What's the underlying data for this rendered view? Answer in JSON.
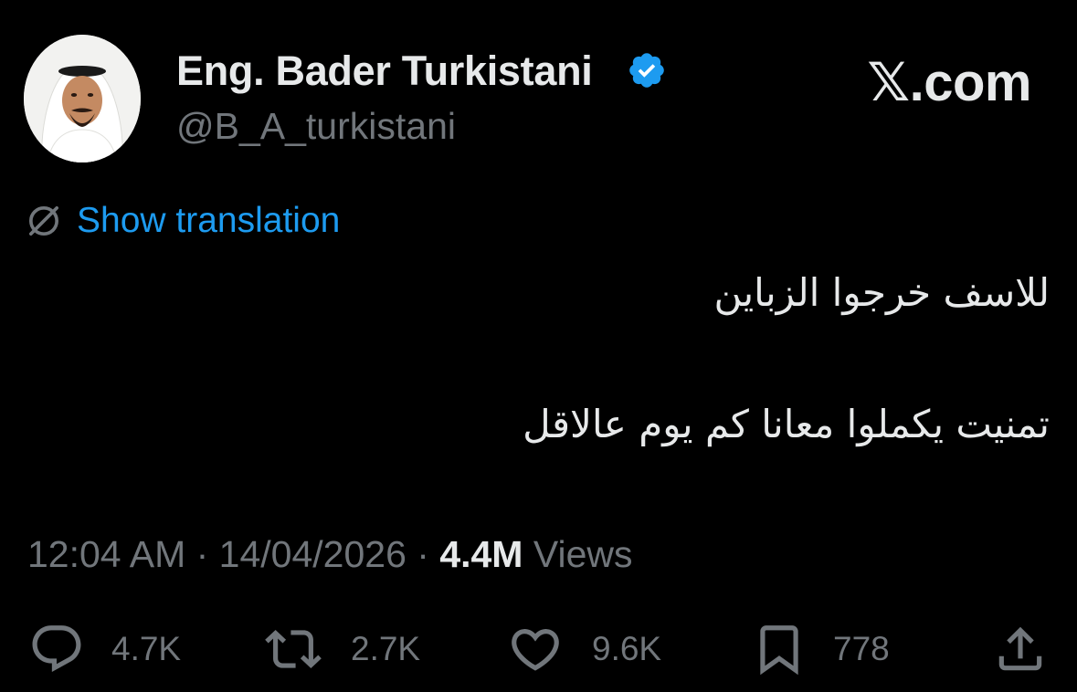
{
  "author": {
    "display_name": "Eng. Bader Turkistani",
    "handle": "@B_A_turkistani"
  },
  "brand": "𝕏.com",
  "translate": {
    "label": "Show translation",
    "icon": "globe-icon"
  },
  "tweet": {
    "lines": [
      "للاسف خرجوا الزباين",
      "تمنيت يكملوا معانا كم يوم عالاقل"
    ]
  },
  "meta": {
    "time": "12:04 AM",
    "separator": " · ",
    "date": "14/04/2026",
    "views_count": "4.4M",
    "views_label": "Views"
  },
  "actions": {
    "replies": {
      "icon": "reply-icon",
      "count": "4.7K"
    },
    "reposts": {
      "icon": "repost-icon",
      "count": "2.7K"
    },
    "likes": {
      "icon": "heart-icon",
      "count": "9.6K"
    },
    "bookmarks": {
      "icon": "bookmark-icon",
      "count": "778"
    },
    "share": {
      "icon": "share-icon"
    }
  },
  "colors": {
    "background": "#000000",
    "primary_text": "#e7e9ea",
    "secondary_text": "#71767b",
    "link": "#1d9bf0",
    "verified_badge": "#1d9bf0"
  }
}
